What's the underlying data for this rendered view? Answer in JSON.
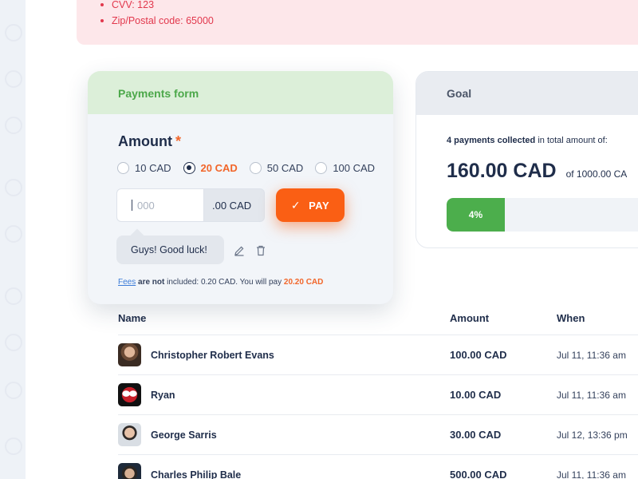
{
  "errors": [
    "CVV: 123",
    "Zip/Postal code: 65000"
  ],
  "payments_form": {
    "title": "Payments form",
    "amount_label": "Amount",
    "required_mark": "*",
    "options": [
      "10 CAD",
      "20 CAD",
      "50 CAD",
      "100 CAD"
    ],
    "selected_option": "20 CAD",
    "amount_placeholder": "000",
    "amount_suffix": ".00 CAD",
    "pay_button": "PAY",
    "comment": "Guys! Good luck!",
    "fees": {
      "link": "Fees",
      "not_included": "are not",
      "text": " included: 0.20 CAD. You will pay ",
      "total": "20.20 CAD"
    }
  },
  "goal": {
    "title": "Goal",
    "collected_bold": "4 payments collected",
    "collected_rest": " in total amount of:",
    "amount": "160.00 CAD",
    "of_target": "of 1000.00 CA",
    "progress_label": "4%",
    "progress_fraction": 0.27
  },
  "table": {
    "headers": {
      "name": "Name",
      "amount": "Amount",
      "when": "When"
    },
    "rows": [
      {
        "name": "Christopher Robert Evans",
        "amount": "100.00 CAD",
        "when": "Jul 11, 11:36 am",
        "avatar": "avatar-photo"
      },
      {
        "name": "Ryan",
        "amount": "10.00 CAD",
        "when": "Jul 11, 11:36 am",
        "avatar": "avatar-mask"
      },
      {
        "name": "George Sarris",
        "amount": "30.00 CAD",
        "when": "Jul 12, 13:36 pm",
        "avatar": "avatar-photo"
      },
      {
        "name": "Charles Philip Bale",
        "amount": "500.00 CAD",
        "when": "Jul 11, 11:36 am",
        "avatar": "avatar-photo"
      }
    ]
  },
  "colors": {
    "accent": "#fa5f14",
    "success": "#4cae4c",
    "error": "#e2384d",
    "ink": "#1f2d4a"
  }
}
